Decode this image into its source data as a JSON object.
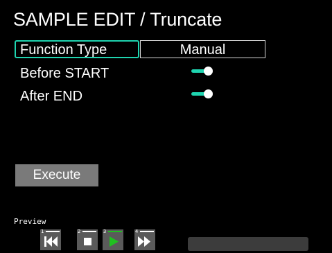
{
  "header": {
    "title": "SAMPLE EDIT / Truncate"
  },
  "params": {
    "function_type": {
      "label": "Function Type",
      "value": "Manual"
    },
    "before_start": {
      "label": "Before START",
      "state": "on"
    },
    "after_end": {
      "label": "After END",
      "state": "on"
    }
  },
  "actions": {
    "execute_label": "Execute"
  },
  "preview": {
    "label": "Preview",
    "buttons": [
      {
        "num": "1",
        "icon": "skip-to-start-icon"
      },
      {
        "num": "2",
        "icon": "stop-icon"
      },
      {
        "num": "3",
        "icon": "play-icon"
      },
      {
        "num": "4",
        "icon": "fast-forward-icon"
      }
    ]
  },
  "colors": {
    "accent": "#1fd4b0",
    "play_active": "#20c020",
    "button_gray": "#7a7a7a"
  }
}
